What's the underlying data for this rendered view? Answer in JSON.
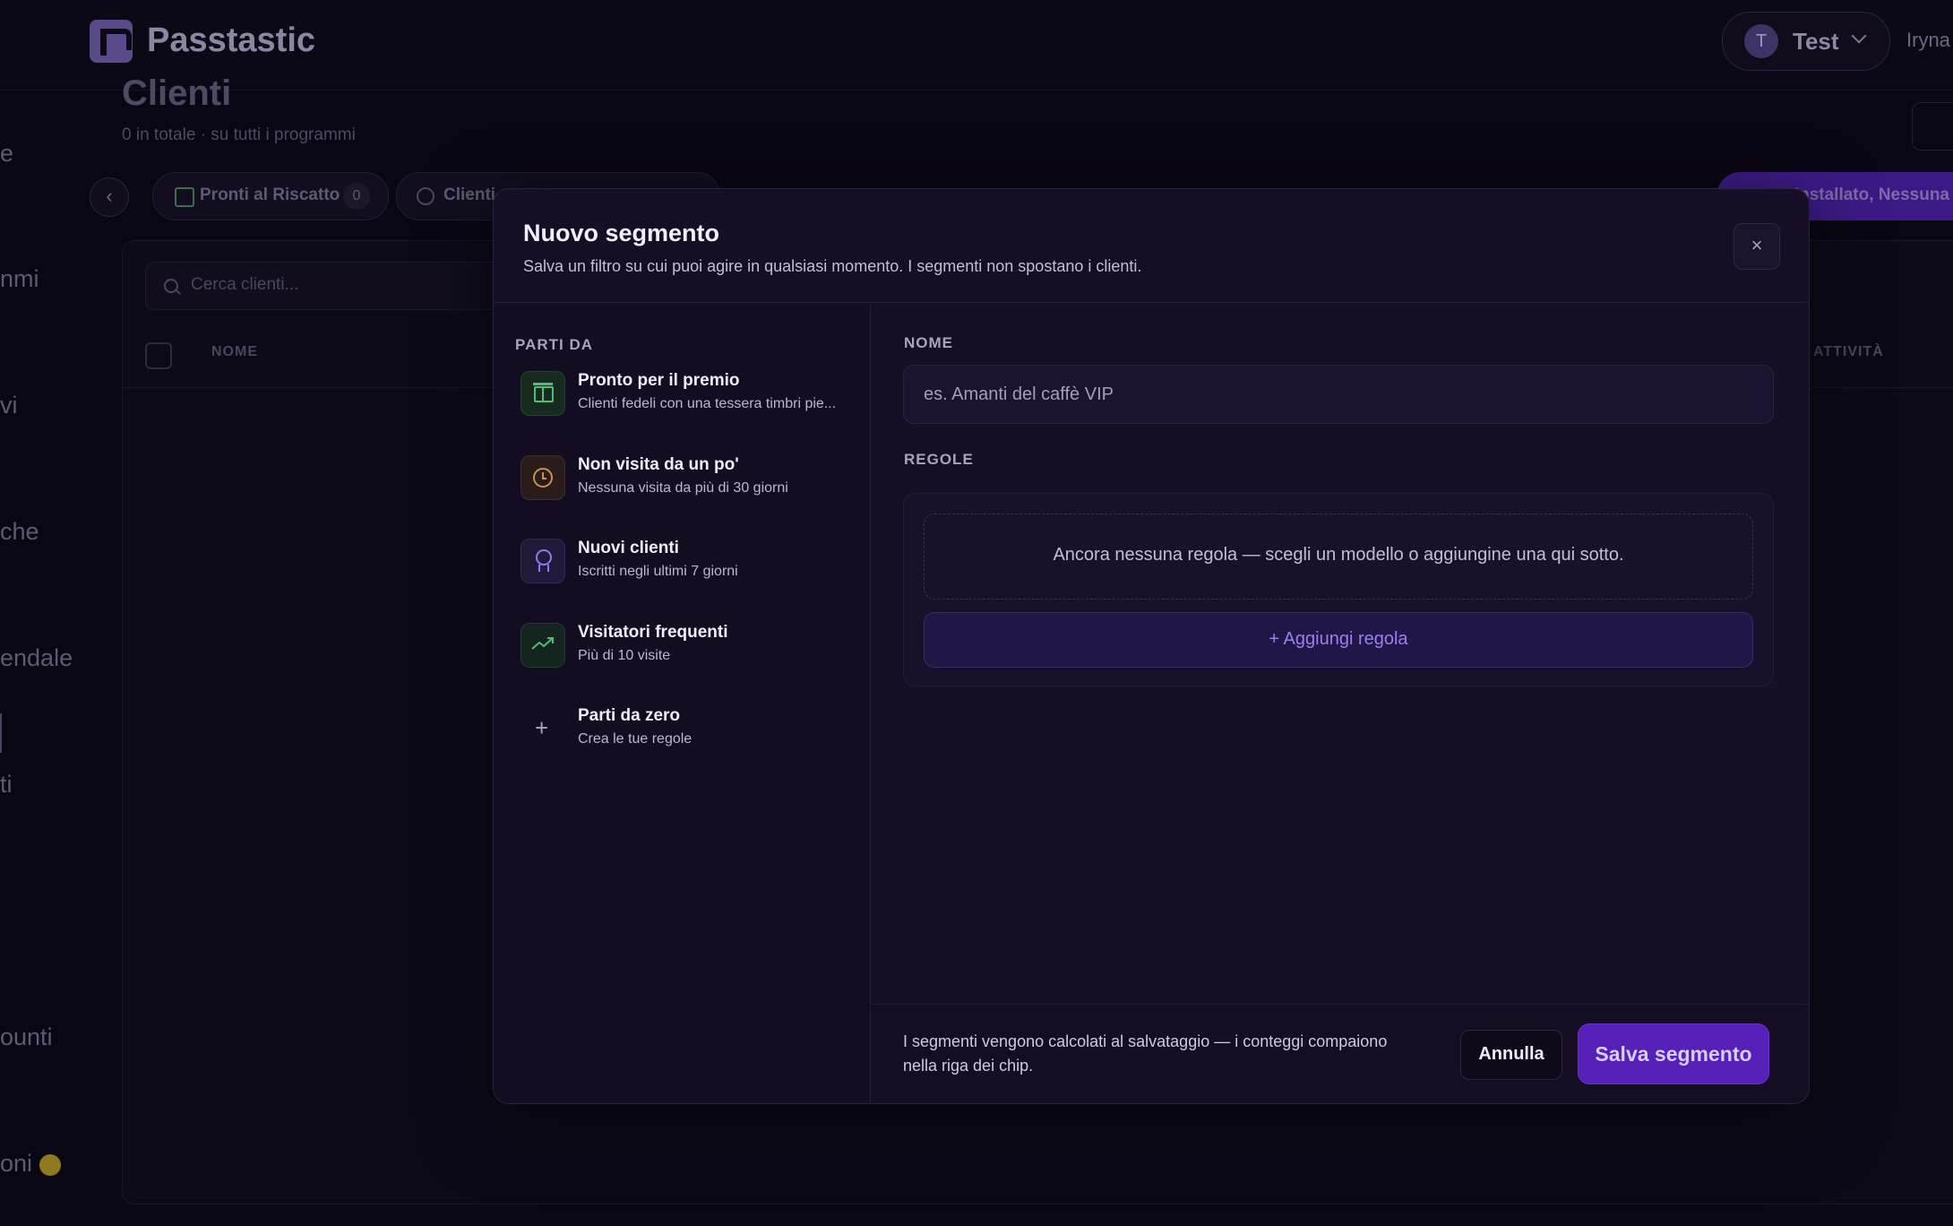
{
  "app": {
    "brand": "Passtastic"
  },
  "header": {
    "account_initial": "T",
    "account_name": "Test",
    "user_name": "Iryna"
  },
  "sidebar": {
    "fragments": [
      "e",
      "nmi",
      "vi",
      "che",
      "endale",
      "ti",
      "ounti",
      "oni"
    ]
  },
  "page": {
    "title": "Clienti",
    "subtitle": "0 in totale · su tutti i programmi"
  },
  "chips": [
    {
      "label": "Pronti al Riscatto",
      "count": "0"
    },
    {
      "label": "Clienti"
    }
  ],
  "chip_right_label": "Installato, Nessuna",
  "table": {
    "search_placeholder": "Cerca clienti...",
    "col_name": "NOME",
    "col_activity": "ATTIVITÀ"
  },
  "modal": {
    "title": "Nuovo segmento",
    "subtitle": "Salva un filtro su cui puoi agire in qualsiasi momento. I segmenti non spostano i clienti.",
    "close_icon": "×",
    "start_from_label": "PARTI DA",
    "templates": [
      {
        "title": "Pronto per il premio",
        "desc": "Clienti fedeli con una tessera timbri pie...",
        "icon": "gift-icon",
        "color": "#4fbf73"
      },
      {
        "title": "Non visita da un po'",
        "desc": "Nessuna visita da più di 30 giorni",
        "icon": "clock-icon",
        "color": "#c69255"
      },
      {
        "title": "Nuovi clienti",
        "desc": "Iscritti negli ultimi 7 giorni",
        "icon": "award-icon",
        "color": "#8f7af0"
      },
      {
        "title": "Visitatori frequenti",
        "desc": "Più di 10 visite",
        "icon": "trending-up-icon",
        "color": "#4fbf73"
      },
      {
        "title": "Parti da zero",
        "desc": "Crea le tue regole",
        "icon": "plus-icon"
      }
    ],
    "name_label": "NOME",
    "name_placeholder": "es. Amanti del caffè VIP",
    "rules_label": "REGOLE",
    "empty_rules": "Ancora nessuna regola — scegli un modello o aggiungine una qui sotto.",
    "add_rule": "+ Aggiungi regola",
    "footer_note": "I segmenti vengono calcolati al salvataggio — i conteggi compaiono nella riga dei chip.",
    "cancel": "Annulla",
    "save": "Salva segmento"
  }
}
